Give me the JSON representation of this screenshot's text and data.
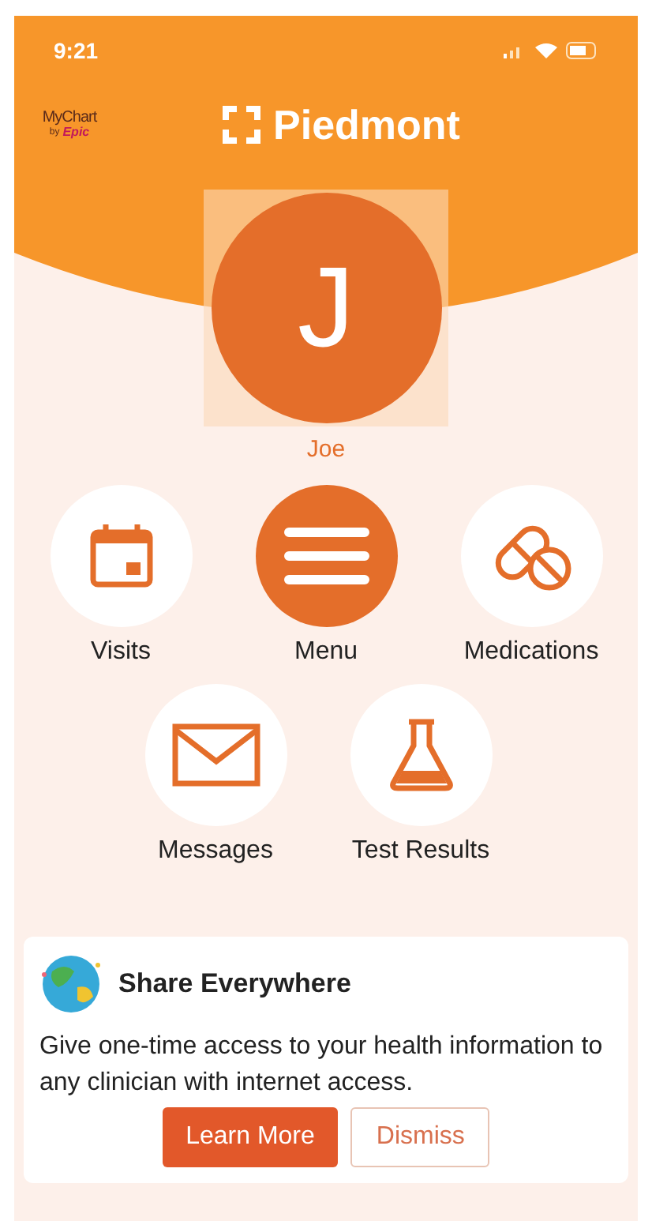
{
  "status_bar": {
    "time": "9:21"
  },
  "header": {
    "logo_top": "MyChart",
    "logo_by": "by",
    "logo_brand": "Epic",
    "title": "Piedmont"
  },
  "profile": {
    "initial": "J",
    "name": "Joe"
  },
  "shortcuts": [
    {
      "kind": "calendar",
      "label": "Visits",
      "highlighted": false
    },
    {
      "kind": "menu",
      "label": "Menu",
      "highlighted": true
    },
    {
      "kind": "pills",
      "label": "Medications",
      "highlighted": false
    },
    {
      "kind": "envelope",
      "label": "Messages",
      "highlighted": false
    },
    {
      "kind": "flask",
      "label": "Test Results",
      "highlighted": false
    }
  ],
  "card": {
    "title": "Share Everywhere",
    "body": "Give one-time access to your health information to any clinician with internet access.",
    "buttons": [
      {
        "kind": "primary",
        "label": "Learn More"
      },
      {
        "kind": "secondary",
        "label": "Dismiss"
      }
    ]
  }
}
